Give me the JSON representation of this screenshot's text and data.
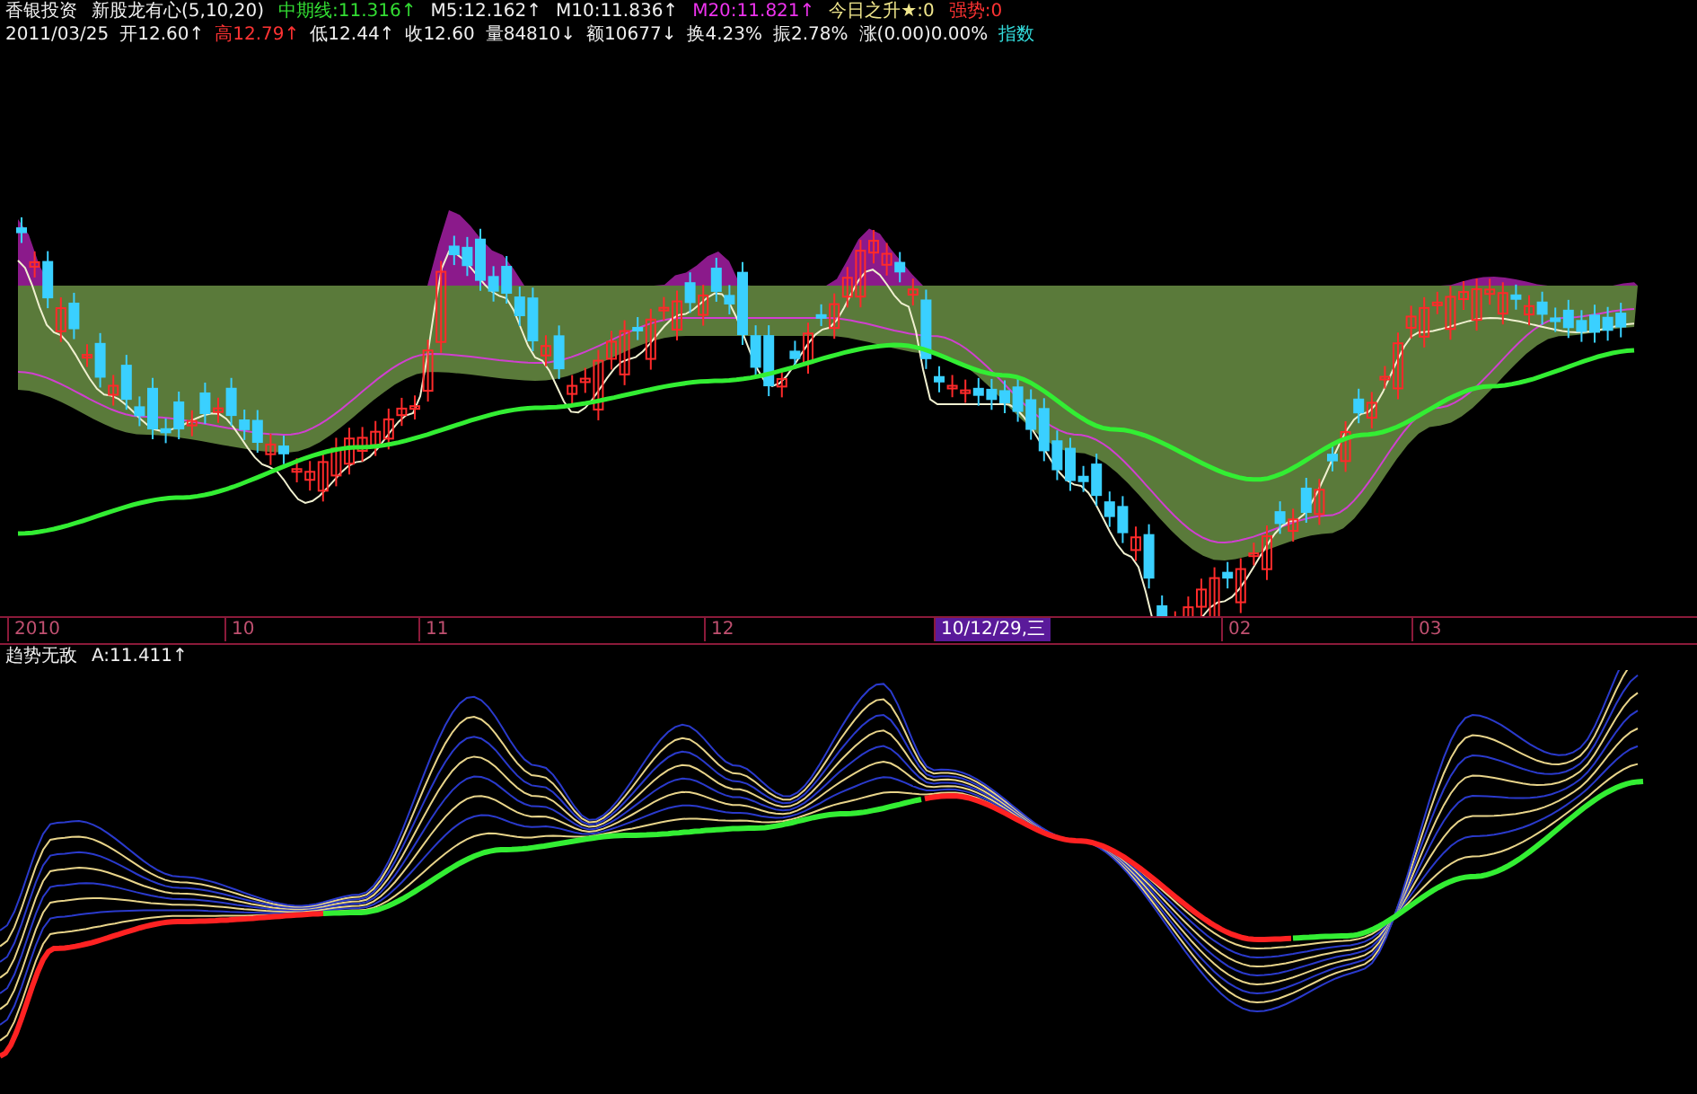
{
  "indicator_line": [
    {
      "text": "香银投资",
      "color": "#f0f0f0"
    },
    {
      "text": "新股龙有心(5,10,20)",
      "color": "#f0f0f0"
    },
    {
      "text": "中期线:11.316↑",
      "color": "#33dd33"
    },
    {
      "text": "M5:12.162↑",
      "color": "#f0f0f0"
    },
    {
      "text": "M10:11.836↑",
      "color": "#f0f0f0"
    },
    {
      "text": "M20:11.821↑",
      "color": "#ee33ee"
    },
    {
      "text": "今日之升★:0",
      "color": "#f0e68c"
    },
    {
      "text": "强势:0",
      "color": "#ff3333"
    }
  ],
  "price_line": [
    {
      "text": "2011/03/25",
      "color": "#f0f0f0"
    },
    {
      "text": "开12.60↑",
      "color": "#f0f0f0"
    },
    {
      "text": "高12.79↑",
      "color": "#ff3333"
    },
    {
      "text": "低12.44↑",
      "color": "#f0f0f0"
    },
    {
      "text": "收12.60",
      "color": "#f0f0f0"
    },
    {
      "text": "量84810↓",
      "color": "#f0f0f0"
    },
    {
      "text": "额10677↓",
      "color": "#f0f0f0"
    },
    {
      "text": "换4.23%",
      "color": "#f0f0f0"
    },
    {
      "text": "振2.78%",
      "color": "#f0f0f0"
    },
    {
      "text": "涨(0.00)0.00%",
      "color": "#f0f0f0"
    },
    {
      "text": "指数",
      "color": "#33dddd"
    }
  ],
  "time_axis": {
    "labels": [
      {
        "text": "2010",
        "selected": false
      },
      {
        "text": "10",
        "selected": false
      },
      {
        "text": "11",
        "selected": false
      },
      {
        "text": "12",
        "selected": false
      },
      {
        "text": "10/12/29,三",
        "selected": true
      },
      {
        "text": "02",
        "selected": false
      },
      {
        "text": "03",
        "selected": false
      }
    ]
  },
  "lower_panel": {
    "title": "趋势无敌",
    "reading": "A:11.411↑"
  }
}
